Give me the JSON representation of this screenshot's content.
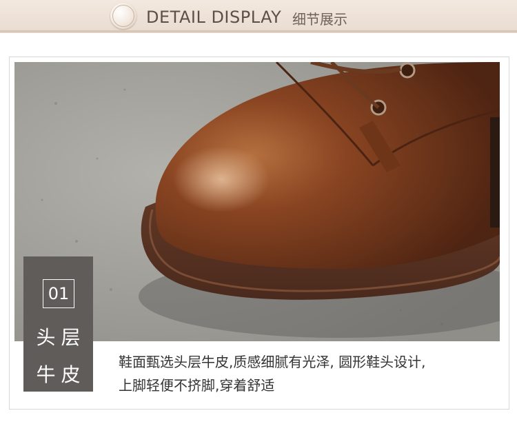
{
  "header": {
    "title": "DETAIL DISPLAY",
    "subtitle": "细节展示",
    "icon": "circle-ornament-icon"
  },
  "badge": {
    "number": "01",
    "line1": "头层",
    "line2": "牛皮"
  },
  "description": {
    "line1": "鞋面甄选头层牛皮,质感细腻有光泽, 圆形鞋头设计,",
    "line2": "上脚轻便不挤脚,穿着舒适"
  },
  "colors": {
    "header_bg": "#ece0d6",
    "badge_bg": "#605c59",
    "leather": "#7a3f1f",
    "text": "#333333"
  }
}
